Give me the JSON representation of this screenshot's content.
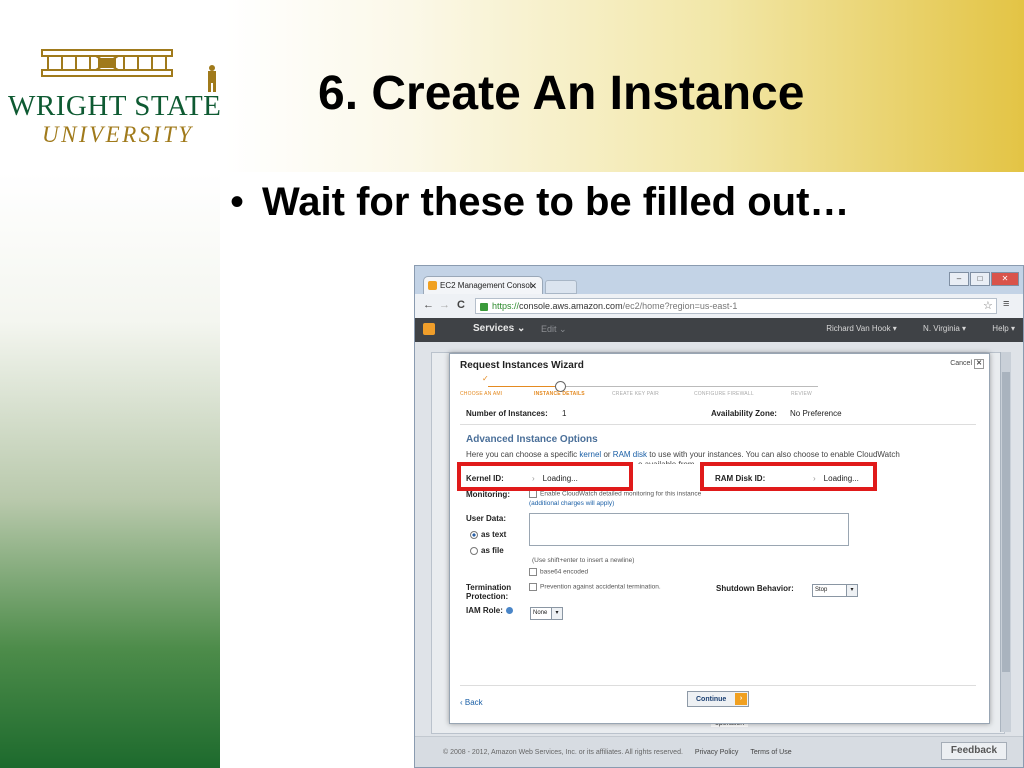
{
  "slide": {
    "title": "6. Create An Instance",
    "bullet": "Wait for these to be filled out…",
    "logo": {
      "name": "WRIGHT STATE",
      "subtitle": "UNIVERSITY"
    }
  },
  "browser": {
    "tab_label": "EC2 Management Consol",
    "url_https": "https://",
    "url_host": "console.aws.amazon.com",
    "url_path": "/ec2/home?region=us-east-1"
  },
  "aws_bar": {
    "services": "Services",
    "edit": "Edit",
    "user": "Richard Van Hook",
    "region": "N. Virginia",
    "help": "Help"
  },
  "wizard": {
    "title": "Request Instances Wizard",
    "cancel": "Cancel",
    "steps": [
      "CHOOSE AN AMI",
      "INSTANCE DETAILS",
      "CREATE KEY PAIR",
      "CONFIGURE FIREWALL",
      "REVIEW"
    ],
    "instances_label": "Number of Instances:",
    "instances_value": "1",
    "zone_label": "Availability Zone:",
    "zone_value": "No Preference",
    "advanced_title": "Advanced Instance Options",
    "desc_prefix": "Here you can choose a specific",
    "desc_kernel": "kernel",
    "desc_or": "or",
    "desc_ramdisk": "RAM disk",
    "desc_suffix": "to use with your instances. You can also choose to enable CloudWatch",
    "desc_line2": "e available from",
    "kernel_label": "Kernel ID:",
    "kernel_value": "Loading...",
    "ramdisk_label": "RAM Disk ID:",
    "ramdisk_value": "Loading...",
    "monitoring_label": "Monitoring:",
    "monitoring_text": "Enable CloudWatch detailed monitoring for this instance",
    "monitoring_note": "(additional charges will apply)",
    "userdata_label": "User Data:",
    "as_text": "as text",
    "as_file": "as file",
    "newline_hint": "(Use shift+enter to insert a newline)",
    "base64": "base64 encoded",
    "termination_label_1": "Termination",
    "termination_label_2": "Protection:",
    "termination_text": "Prevention against accidental termination.",
    "shutdown_label": "Shutdown Behavior:",
    "shutdown_value": "Stop",
    "iam_label": "IAM Role:",
    "iam_value": "None",
    "back": "‹ Back",
    "continue": "Continue"
  },
  "footer": {
    "copyright": "© 2008 - 2012, Amazon Web Services, Inc. or its affiliates. All rights reserved.",
    "privacy": "Privacy Policy",
    "terms": "Terms of Use",
    "feedback": "Feedback",
    "operation": "operation"
  },
  "colors": {
    "highlight": "#e01a1a",
    "wsu_green": "#0e5a32",
    "wsu_gold": "#a07a1b",
    "aws_orange": "#f09e2a"
  }
}
